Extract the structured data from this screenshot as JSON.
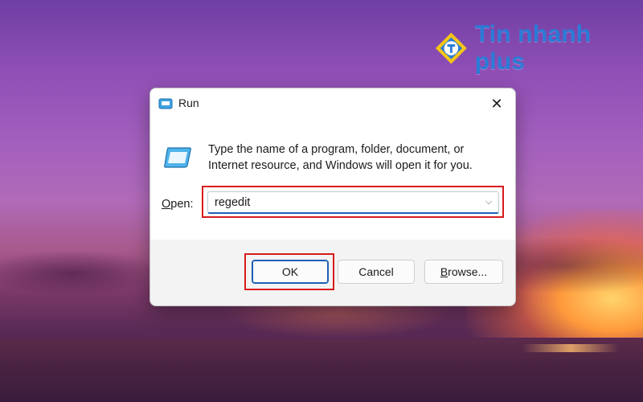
{
  "watermark": {
    "brand": "Tin nhanh plus"
  },
  "dialog": {
    "title": "Run",
    "icon": "run-icon",
    "close_symbol": "✕",
    "description": "Type the name of a program, folder, document, or Internet resource, and Windows will open it for you.",
    "open_label_accel": "O",
    "open_label_rest": "pen:",
    "input_value": "regedit",
    "dropdown_symbol": "⌵",
    "buttons": {
      "ok": "OK",
      "cancel": "Cancel",
      "browse_accel": "B",
      "browse_rest": "rowse..."
    }
  },
  "colors": {
    "highlight": "#d81b1b",
    "accent": "#1f5fb5",
    "brand": "#2b7bd6"
  }
}
